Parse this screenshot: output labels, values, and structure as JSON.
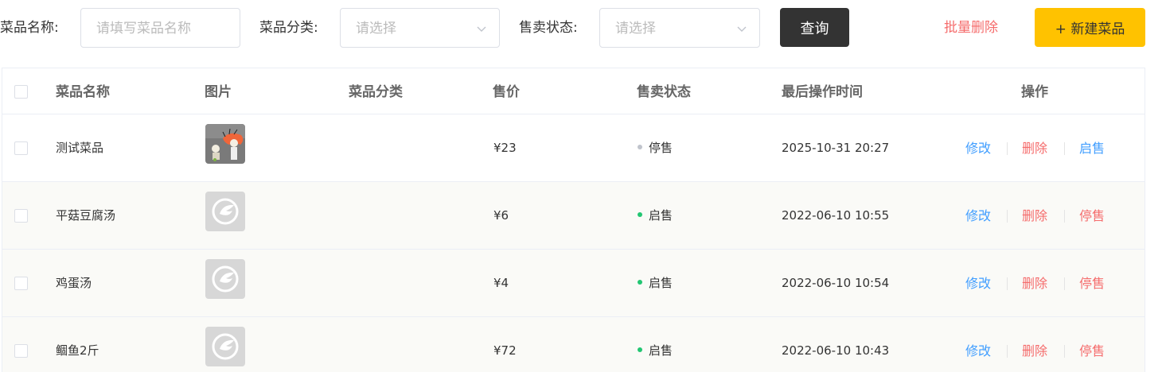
{
  "filters": {
    "name_label": "菜品名称:",
    "name_placeholder": "请填写菜品名称",
    "category_label": "菜品分类:",
    "category_placeholder": "请选择",
    "status_label": "售卖状态:",
    "status_placeholder": "请选择",
    "query_button": "查询",
    "batch_delete": "批量删除",
    "new_dish": "+ 新建菜品"
  },
  "table": {
    "headers": {
      "name": "菜品名称",
      "image": "图片",
      "category": "菜品分类",
      "price": "售价",
      "status": "售卖状态",
      "updated": "最后操作时间",
      "actions": "操作"
    },
    "rows": [
      {
        "name": "测试菜品",
        "image": "photo",
        "category": "",
        "price": "¥23",
        "status": "停售",
        "status_color": "#c0c4cc",
        "updated": "2025-10-31 20:27",
        "edit": "修改",
        "delete": "删除",
        "toggle": "启售",
        "toggle_color": "#419eff"
      },
      {
        "name": "平菇豆腐汤",
        "image": "placeholder-logo",
        "category": "",
        "price": "¥6",
        "status": "启售",
        "status_color": "#22c672",
        "updated": "2022-06-10 10:55",
        "edit": "修改",
        "delete": "删除",
        "toggle": "停售",
        "toggle_color": "#f56c6c"
      },
      {
        "name": "鸡蛋汤",
        "image": "placeholder-logo",
        "category": "",
        "price": "¥4",
        "status": "启售",
        "status_color": "#22c672",
        "updated": "2022-06-10 10:54",
        "edit": "修改",
        "delete": "删除",
        "toggle": "停售",
        "toggle_color": "#f56c6c"
      },
      {
        "name": "鲴鱼2斤",
        "image": "placeholder-logo",
        "category": "",
        "price": "¥72",
        "status": "启售",
        "status_color": "#22c672",
        "updated": "2022-06-10 10:43",
        "edit": "修改",
        "delete": "删除",
        "toggle": "停售",
        "toggle_color": "#f56c6c"
      }
    ]
  },
  "colors": {
    "accent": "#ffc200",
    "dark_button": "#333333",
    "danger": "#f56c6c",
    "link": "#419eff",
    "on_sale": "#22c672",
    "off_sale": "#c0c4cc"
  }
}
